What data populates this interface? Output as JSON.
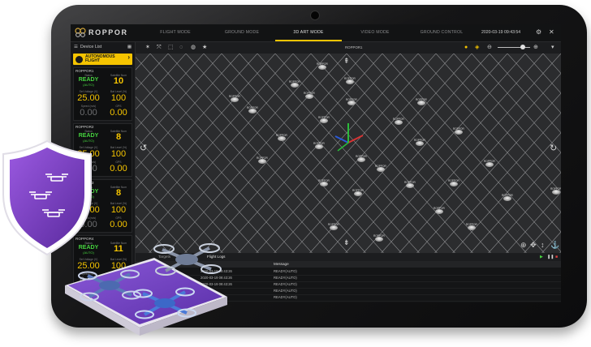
{
  "app": {
    "brand": "ROPPOR",
    "datetime": "2020-03-19 09:43:54",
    "tabs": [
      "FLIGHT MODE",
      "GROUND MODE",
      "3D ART MODE",
      "VIDEO MODE",
      "GROUND CONTROL"
    ],
    "active_tab": "3D ART MODE",
    "icons": {
      "settings": "gear-icon",
      "close": "close-icon"
    }
  },
  "sidebar": {
    "title": "Device List",
    "auto_button_line1": "AUTONOMOUS",
    "auto_button_line2": "FLIGHT",
    "auto_button_arrow": "›",
    "labels": {
      "status": "Status",
      "satellite": "Satellite Num",
      "set_voltage": "Set Voltage (V)",
      "bat_level": "Bat Level (%)",
      "speed": "Speed (m/s)",
      "gps": "GPS"
    },
    "devices": [
      {
        "name": "ROPPOR1",
        "status": "READY",
        "mode": "(AUTO)",
        "satellite": "10",
        "voltage": "25.00",
        "battery": "100",
        "speed": "0.00",
        "gps": "0.00"
      },
      {
        "name": "ROPPOR2",
        "status": "READY",
        "mode": "(AUTO)",
        "satellite": "8",
        "voltage": "25.00",
        "battery": "100",
        "speed": "0.00",
        "gps": "0.00"
      },
      {
        "name": "ROPPOR3",
        "status": "READY",
        "mode": "(AUTO)",
        "satellite": "8",
        "voltage": "25.00",
        "battery": "100",
        "speed": "0.00",
        "gps": "0.00"
      },
      {
        "name": "ROPPOR4",
        "status": "READY",
        "mode": "(AUTO)",
        "satellite": "11",
        "voltage": "25.00",
        "battery": "100",
        "speed": "0.00",
        "gps": "0.00"
      }
    ]
  },
  "viewport": {
    "title": "ROPPOR1",
    "drone_label": "ROPPOR",
    "drone_count": 28
  },
  "logs": {
    "tabs": [
      "Targets",
      "Flight Logs"
    ],
    "active_tab": "Flight Logs",
    "column": "Message",
    "rows": [
      "READY(AUTO)",
      "READY(AUTO)",
      "READY(AUTO)",
      "READY(AUTO)",
      "READY(AUTO)"
    ],
    "timestamps": [
      "2020-03-19 09:43:26",
      "2020-03-19 09:43:26",
      "2020-03-19 09:43:26"
    ]
  },
  "colors": {
    "accent": "#f5c400",
    "status_green": "#46d23f",
    "shield_purple": "#7a3fc8",
    "platform_purple": "#6a3ab0"
  }
}
